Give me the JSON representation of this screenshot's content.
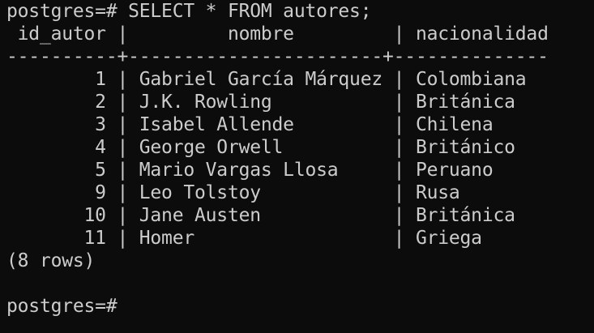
{
  "terminal": {
    "prompt": "postgres=#",
    "command": "SELECT * FROM autores;",
    "columns": [
      "id_autor",
      "nombre",
      "nacionalidad"
    ],
    "separator": "----------+-----------------------+--------------",
    "rows": [
      {
        "id_autor": "1",
        "nombre": "Gabriel García Márquez",
        "nacionalidad": "Colombiana"
      },
      {
        "id_autor": "2",
        "nombre": "J.K. Rowling",
        "nacionalidad": "Británica"
      },
      {
        "id_autor": "3",
        "nombre": "Isabel Allende",
        "nacionalidad": "Chilena"
      },
      {
        "id_autor": "4",
        "nombre": "George Orwell",
        "nacionalidad": "Británico"
      },
      {
        "id_autor": "5",
        "nombre": "Mario Vargas Llosa",
        "nacionalidad": "Peruano"
      },
      {
        "id_autor": "9",
        "nombre": "Leo Tolstoy",
        "nacionalidad": "Rusa"
      },
      {
        "id_autor": "10",
        "nombre": "Jane Austen",
        "nacionalidad": "Británica"
      },
      {
        "id_autor": "11",
        "nombre": "Homer",
        "nacionalidad": "Griega"
      }
    ],
    "row_count": "(8 rows)",
    "final_prompt": "postgres=#"
  }
}
